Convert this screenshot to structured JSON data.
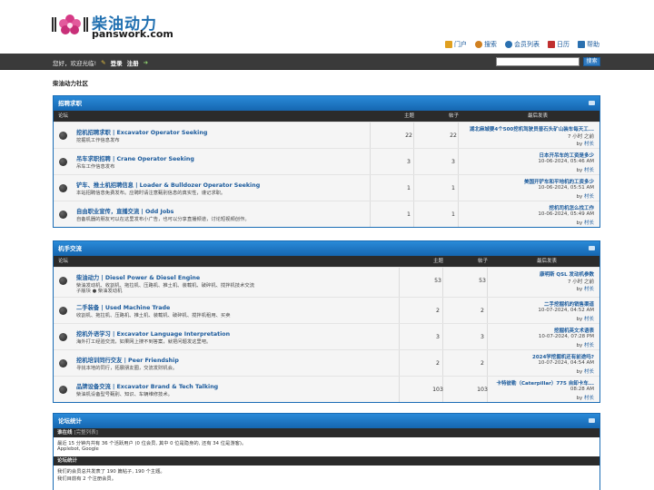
{
  "brand": {
    "name_cn": "柴油动力",
    "name_en": "panswork.com"
  },
  "toplinks": [
    {
      "label": "门户",
      "icon": "portal-icon",
      "color": "#e0a020"
    },
    {
      "label": "搜索",
      "icon": "search-icon",
      "color": "#d08020"
    },
    {
      "label": "会员列表",
      "icon": "members-icon",
      "color": "#2a70b0"
    },
    {
      "label": "日历",
      "icon": "calendar-icon",
      "color": "#c03030"
    },
    {
      "label": "帮助",
      "icon": "help-icon",
      "color": "#2a70b0"
    }
  ],
  "navbar": {
    "greeting": "您好，欢迎光临!",
    "login": "登录",
    "register": "注册",
    "search_button": "搜索"
  },
  "breadcrumb": "柴油动力社区",
  "columns": {
    "forum": "论坛",
    "topics": "主题",
    "posts": "帖子",
    "last_post": "最后发表"
  },
  "categories": [
    {
      "title": "招聘求职",
      "forums": [
        {
          "title": "挖机招聘求职 | Excavator Operator Seeking",
          "desc": "挖掘机工作信息发布",
          "desc2": "",
          "topics": "22",
          "posts": "22",
          "last_title": "湖北麻城要4个500挖机驾驶员普石头矿山装车每天工...",
          "last_date": "7 小时 之前",
          "last_by": "by",
          "last_user": "村长"
        },
        {
          "title": "吊车求职招聘 | Crane Operator Seeking",
          "desc": "吊车工作信息发布",
          "desc2": "",
          "topics": "3",
          "posts": "3",
          "last_title": "日本开吊车的工资是多少",
          "last_date": "10-06-2024, 05:46 AM",
          "last_by": "by",
          "last_user": "村长"
        },
        {
          "title": "铲车、推土机招聘信息 | Loader & Bulldozer Operator Seeking",
          "desc": "本站招聘信息免费发布。应聘时请注意甄别信息的真实性，谨记求职。",
          "desc2": "",
          "topics": "1",
          "posts": "1",
          "last_title": "美国开铲车和平地机的工资多少",
          "last_date": "10-06-2024, 05:51 AM",
          "last_by": "by",
          "last_user": "村长"
        },
        {
          "title": "自由职业宣传，直播交流 | Odd Jobs",
          "desc": "自备机器的朋友可以在这里发布小广告，也可以分享直播频道，讨论短视频创作。",
          "desc2": "",
          "topics": "1",
          "posts": "1",
          "last_title": "挖机司机怎么找工作",
          "last_date": "10-06-2024, 05:49 AM",
          "last_by": "by",
          "last_user": "村长"
        }
      ]
    },
    {
      "title": "机手交流",
      "forums": [
        {
          "title": "柴油动力 | Diesel Power & Diesel Engine",
          "desc": "柴油发动机、收割机、拖拉机、压路机、推土机、装载机、破碎机、搅拌机技术交流",
          "desc2": "子版块 ● 柴油发动机",
          "topics": "53",
          "posts": "53",
          "last_title": "康明斯 QSL 发动机参数",
          "last_date": "7 小时 之前",
          "last_by": "by",
          "last_user": "村长"
        },
        {
          "title": "二手装备 | Used Machine Trade",
          "desc": "收割机、拖拉机、压路机、推土机、装载机、破碎机、搅拌机租用、买卖",
          "desc2": "",
          "topics": "2",
          "posts": "2",
          "last_title": "二手挖掘机的销售渠道",
          "last_date": "10-07-2024, 04:52 AM",
          "last_by": "by",
          "last_user": "村长"
        },
        {
          "title": "挖机外语学习 | Excavator Language Interpretation",
          "desc": "海外打工经验交流，如果网上搜不到答案，就把问题发这里吧。",
          "desc2": "",
          "topics": "3",
          "posts": "3",
          "last_title": "挖掘机英文术语表",
          "last_date": "10-07-2024, 07:28 PM",
          "last_by": "by",
          "last_user": "村长"
        },
        {
          "title": "挖机培训同行交友 | Peer Friendship",
          "desc": "寻找本地的同行，拓展朋友圈，交流发财机会。",
          "desc2": "",
          "topics": "2",
          "posts": "2",
          "last_title": "2024学挖掘机还有前途吗?",
          "last_date": "10-07-2024, 04:54 AM",
          "last_by": "by",
          "last_user": "村长"
        },
        {
          "title": "品牌设备交流 | Excavator Brand & Tech Talking",
          "desc": "柴油机设备型号甄别、知识、车辆维修技术。",
          "desc2": "",
          "topics": "103",
          "posts": "103",
          "last_title": "卡特彼勒（Caterpillar）775 自卸卡车...",
          "last_date": "08:28 AM",
          "last_by": "by",
          "last_user": "村长"
        }
      ]
    }
  ],
  "stats": {
    "title": "论坛统计",
    "online_head": "谁在线",
    "online_head_small": "[完整列表]",
    "online_line": "最近 15 分钟内共有 36 个活跃用户 (0 位会员, 其中 0 位是隐身的, 还有 34 位是游客)。",
    "online_bots": "Applebot, Google",
    "forum_head": "论坛统计",
    "forum_line1": "我们的会员总共发表了 190 篇帖子, 190 个主题。",
    "forum_line2": "我们目前有 2 个注册会员。"
  }
}
